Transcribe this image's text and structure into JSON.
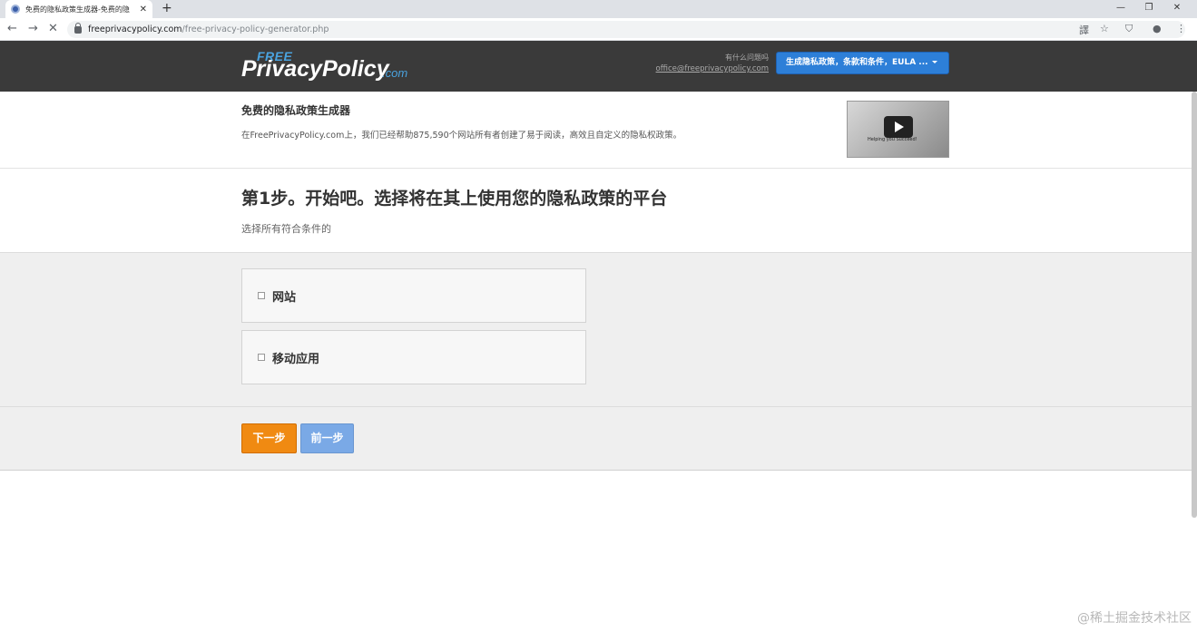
{
  "browser": {
    "tab_title": "免费的隐私政策生成器-免费的隐",
    "tab_close": "✕",
    "new_tab": "+",
    "url_host": "freeprivacypolicy.com",
    "url_path": "/free-privacy-policy-generator.php",
    "controls": {
      "minimize": "—",
      "restore": "❐",
      "close": "✕"
    },
    "nav": {
      "back": "←",
      "forward": "→",
      "reload": "✕"
    },
    "toolbar_icons": {
      "translate": "譯",
      "bookmark": "☆",
      "ext": "⛉",
      "account": "●",
      "menu": "⋮"
    }
  },
  "header": {
    "logo_free": "FREE",
    "logo_main": "PrivacyPolicy",
    "logo_com": ".com",
    "help_question": "有什么问题吗",
    "help_email": "office@freeprivacypolicy.com",
    "generate_button": "生成隐私政策，条款和条件，EULA ..."
  },
  "intro": {
    "title": "免费的隐私政策生成器",
    "description": "在FreePrivacyPolicy.com上，我们已经帮助875,590个网站所有者创建了易于阅读，高效且自定义的隐私权政策。",
    "video_caption": "Helping you Succeed!"
  },
  "step": {
    "title": "第1步。开始吧。选择将在其上使用您的隐私政策的平台",
    "subtitle": "选择所有符合条件的"
  },
  "options": [
    {
      "label": "网站",
      "checked": false
    },
    {
      "label": "移动应用",
      "checked": false
    }
  ],
  "actions": {
    "next": "下一步",
    "previous": "前一步"
  },
  "watermark": "@稀土掘金技术社区"
}
